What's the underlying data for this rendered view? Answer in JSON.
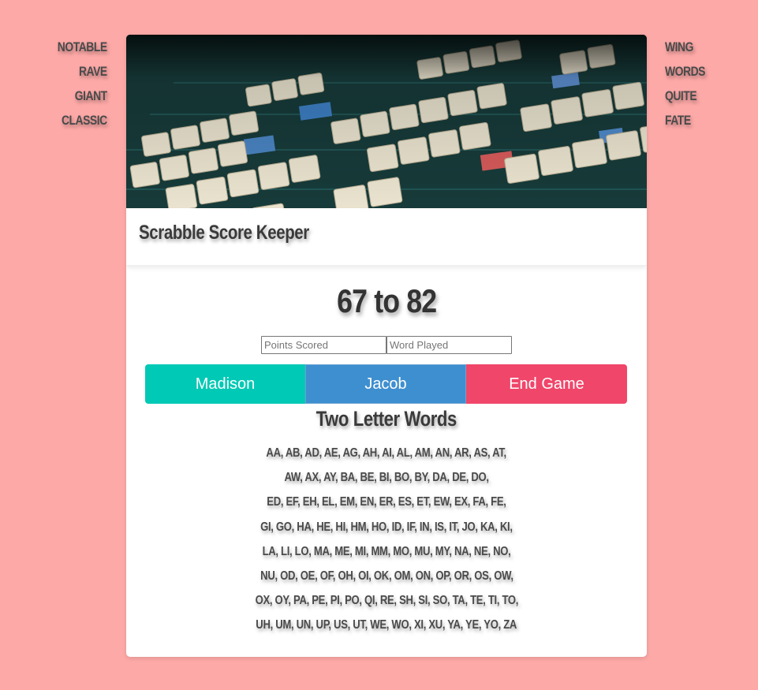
{
  "side_words_left": [
    "NOTABLE",
    "RAVE",
    "GIANT",
    "CLASSIC"
  ],
  "side_words_right": [
    "WING",
    "WORDS",
    "QUITE",
    "FATE"
  ],
  "hero_image": "scrabble-board-photo",
  "header": {
    "title": "Scrabble Score Keeper"
  },
  "score": {
    "display": "67 to 82",
    "player1": 67,
    "player2": 82
  },
  "inputs": {
    "points_placeholder": "Points Scored",
    "points_value": "",
    "word_placeholder": "Word Played",
    "word_value": ""
  },
  "buttons": {
    "player1_label": "Madison",
    "player2_label": "Jacob",
    "end_label": "End Game"
  },
  "colors": {
    "background": "#fda9a7",
    "player1": "#00c9b5",
    "player2": "#3e8fd0",
    "end_game": "#f0466a"
  },
  "two_letter_words": {
    "title": "Two Letter Words",
    "lines": [
      "AA, AB, AD, AE, AG, AH, AI, AL, AM, AN, AR, AS, AT,",
      "AW, AX, AY, BA, BE, BI, BO, BY, DA, DE, DO,",
      "ED, EF, EH, EL, EM, EN, ER, ES, ET, EW, EX, FA, FE,",
      "GI, GO, HA, HE, HI, HM, HO, ID, IF, IN, IS, IT, JO, KA, KI,",
      "LA, LI, LO, MA, ME, MI, MM, MO, MU, MY, NA, NE, NO,",
      "NU, OD, OE, OF, OH, OI, OK, OM, ON, OP, OR, OS, OW,",
      "OX, OY, PA, PE, PI, PO, QI, RE, SH, SI, SO, TA, TE, TI, TO,",
      "UH, UM, UN, UP, US, UT, WE, WO, XI, XU, YA, YE, YO, ZA"
    ]
  }
}
